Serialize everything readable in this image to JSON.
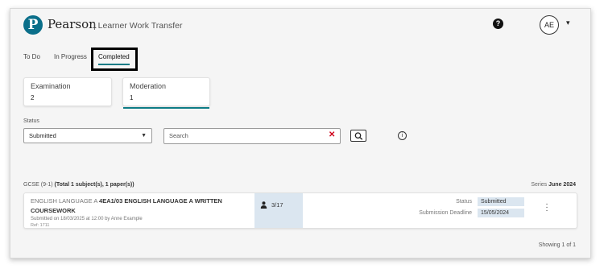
{
  "header": {
    "logo_letter": "P",
    "brand": "Pearson",
    "app_title": "| Learner Work Transfer",
    "help_icon": "?",
    "avatar_initials": "AE",
    "avatar_caret": "▾"
  },
  "tabs": [
    {
      "label": "To Do"
    },
    {
      "label": "In Progress"
    },
    {
      "label": "Completed",
      "active": true
    }
  ],
  "cards": [
    {
      "label": "Examination",
      "count": "2"
    },
    {
      "label": "Moderation",
      "count": "1",
      "active": true
    }
  ],
  "filters": {
    "status_label": "Status",
    "status_value": "Submitted",
    "search_placeholder": "Search",
    "clear_icon": "✕"
  },
  "results": {
    "group_prefix": "GCSE (9-1)",
    "group_summary": "(Total 1 subject(s), 1 paper(s))",
    "series_label": "Series",
    "series_value": "June 2024",
    "rows": [
      {
        "subject_prefix": "ENGLISH LANGUAGE A",
        "subject_bold": "4EA1/03 ENGLISH LANGUAGE A WRITTEN COURSEWORK",
        "submitted_on": "Submitted on 18/03/2025 at 12:00 by Anne Example",
        "ref": "Ref: 1711",
        "progress": "3/17",
        "status_label": "Status",
        "status_value": "Submitted",
        "deadline_label": "Submission Deadline",
        "deadline_value": "15/05/2024"
      }
    ],
    "showing": "Showing 1 of 1"
  },
  "colors": {
    "accent": "#0e7c86",
    "brand": "#0b6f8a",
    "clear": "#d0021b",
    "highlight_cell": "#dbe6f0"
  }
}
